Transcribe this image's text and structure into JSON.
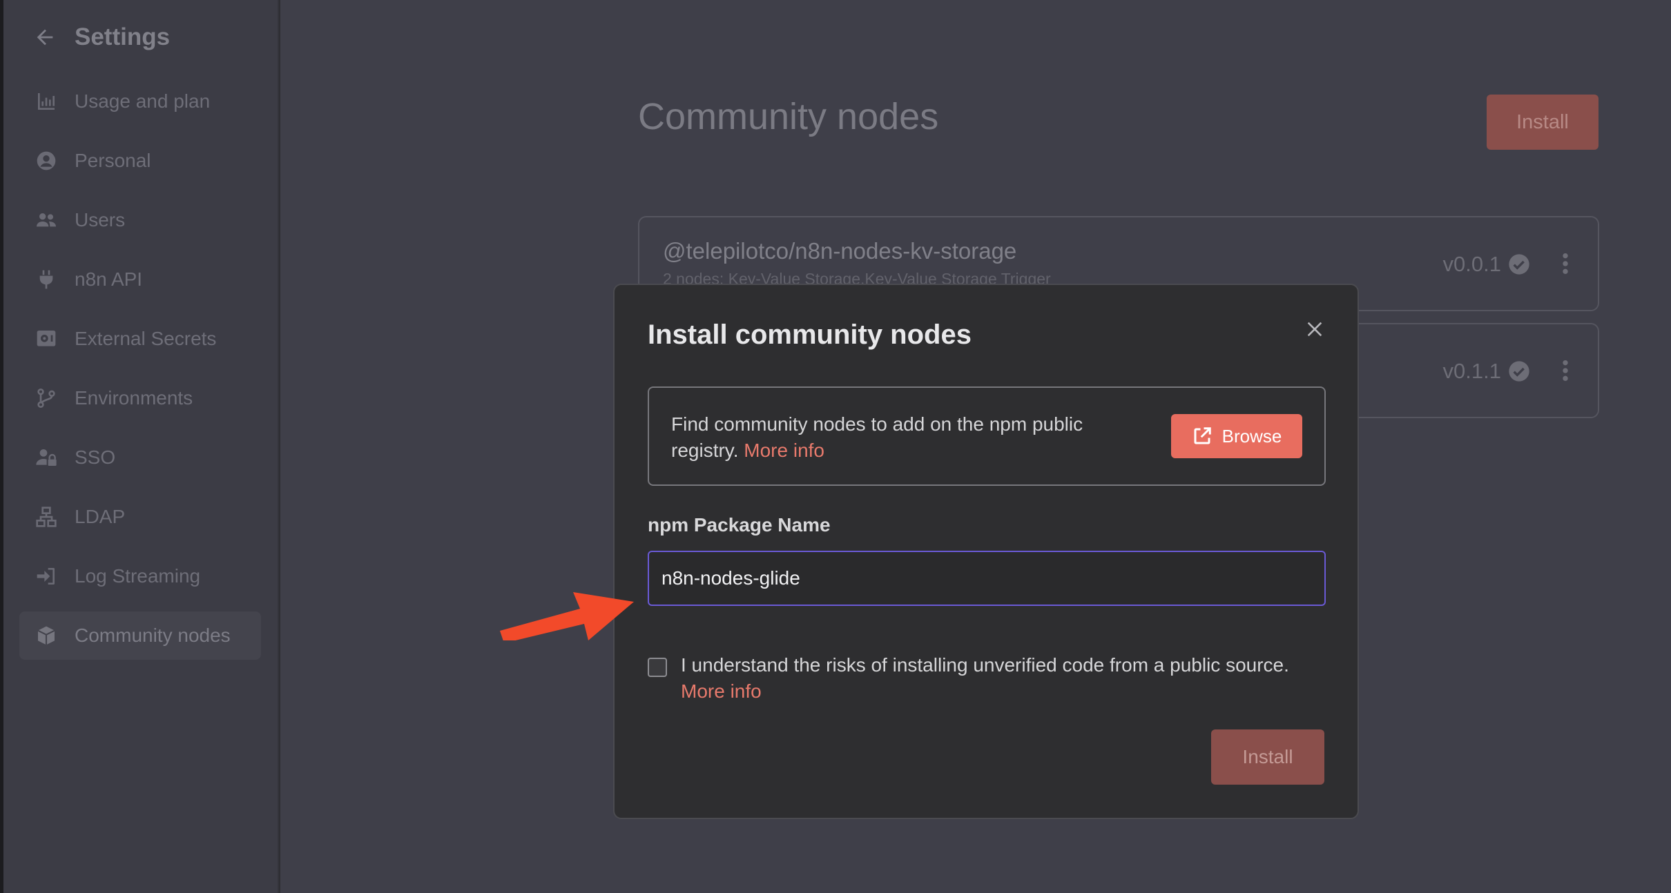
{
  "sidebar": {
    "title": "Settings",
    "items": [
      {
        "label": "Usage and plan",
        "icon": "bar-chart-icon"
      },
      {
        "label": "Personal",
        "icon": "user-circle-icon"
      },
      {
        "label": "Users",
        "icon": "users-icon"
      },
      {
        "label": "n8n API",
        "icon": "plug-icon"
      },
      {
        "label": "External Secrets",
        "icon": "vault-icon"
      },
      {
        "label": "Environments",
        "icon": "git-branch-icon"
      },
      {
        "label": "SSO",
        "icon": "user-lock-icon"
      },
      {
        "label": "LDAP",
        "icon": "network-icon"
      },
      {
        "label": "Log Streaming",
        "icon": "sign-in-icon"
      },
      {
        "label": "Community nodes",
        "icon": "cube-icon",
        "active": true
      }
    ]
  },
  "main": {
    "title": "Community nodes",
    "install_label": "Install",
    "packages": [
      {
        "name": "@telepilotco/n8n-nodes-kv-storage",
        "sub": "2 nodes:  Key-Value Storage,Key-Value Storage Trigger",
        "version": "v0.0.1"
      },
      {
        "name": "",
        "sub": "",
        "version": "v0.1.1"
      }
    ]
  },
  "modal": {
    "title": "Install community nodes",
    "info_text": "Find community nodes to add on the npm public registry.",
    "info_link": "More info",
    "browse_label": "Browse",
    "field_label": "npm Package Name",
    "input_value": "n8n-nodes-glide",
    "consent_text": "I understand the risks of installing unverified code from a public source.",
    "consent_link": "More info",
    "install_label": "Install"
  },
  "colors": {
    "accent": "#e86d5f",
    "focus": "#6a5ad6",
    "annotation_arrow": "#f24a2a"
  }
}
